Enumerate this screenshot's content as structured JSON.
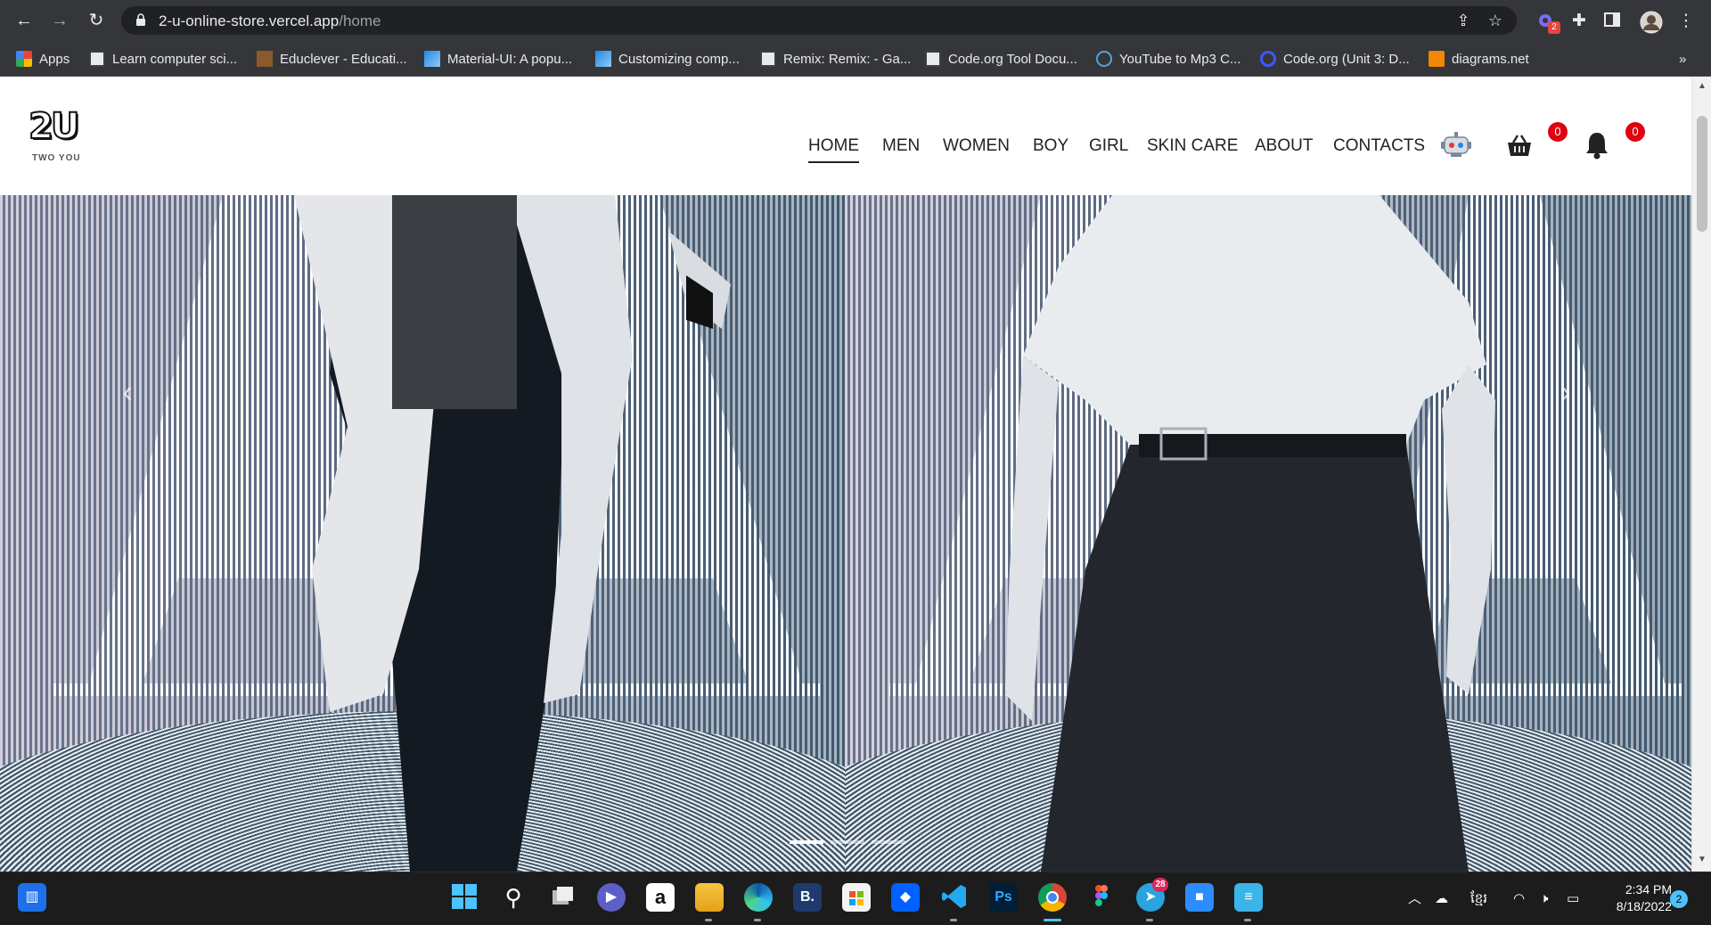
{
  "browser": {
    "url_host": "2-u-online-store.vercel.app",
    "url_path": "/home",
    "extension_badge": "2"
  },
  "bookmarks": [
    {
      "label": "Apps",
      "icon": "apps-grid-icon"
    },
    {
      "label": "Learn computer sci...",
      "icon": "code-org-icon"
    },
    {
      "label": "Educlever - Educati...",
      "icon": "educlever-icon"
    },
    {
      "label": "Material-UI: A popu...",
      "icon": "material-ui-icon"
    },
    {
      "label": "Customizing comp...",
      "icon": "material-ui-icon"
    },
    {
      "label": "Remix: Remix: - Ga...",
      "icon": "code-org-icon"
    },
    {
      "label": "Code.org Tool Docu...",
      "icon": "code-org-icon"
    },
    {
      "label": "YouTube to Mp3 C...",
      "icon": "download-icon"
    },
    {
      "label": "Code.org (Unit 3: D...",
      "icon": "quizlet-icon"
    },
    {
      "label": "diagrams.net",
      "icon": "diagrams-icon"
    }
  ],
  "bookmarks_more": "»",
  "site": {
    "logo_text": "2U",
    "logo_subtitle": "TWO YOU",
    "nav": [
      {
        "label": "HOME",
        "active": true
      },
      {
        "label": "MEN",
        "active": false
      },
      {
        "label": "WOMEN",
        "active": false
      },
      {
        "label": "BOY",
        "active": false
      },
      {
        "label": "GIRL",
        "active": false
      },
      {
        "label": "SKIN CARE",
        "active": false
      },
      {
        "label": "ABOUT",
        "active": false
      },
      {
        "label": "CONTACTS",
        "active": false
      }
    ],
    "cart_count": "0",
    "notification_count": "0",
    "slider": {
      "prev": "‹",
      "next": "›",
      "slide_count": 3,
      "active_slide": 1
    }
  },
  "taskbar": {
    "apps": [
      "start",
      "search",
      "task-view",
      "teams-chat",
      "amazon",
      "file-explorer",
      "edge",
      "b-app",
      "store",
      "dropbox",
      "vscode",
      "photoshop",
      "chrome",
      "figma",
      "telegram",
      "zoom",
      "notepad"
    ],
    "telegram_badge": "28",
    "tray_lang": "ខ្មែរ",
    "time": "2:34 PM",
    "date": "8/18/2022",
    "notification_count": "2"
  },
  "colors": {
    "chrome_bg": "#35363a",
    "omnibox_bg": "#202124",
    "badge_red": "#e00012",
    "taskbar_bg": "#1c1c1c"
  }
}
